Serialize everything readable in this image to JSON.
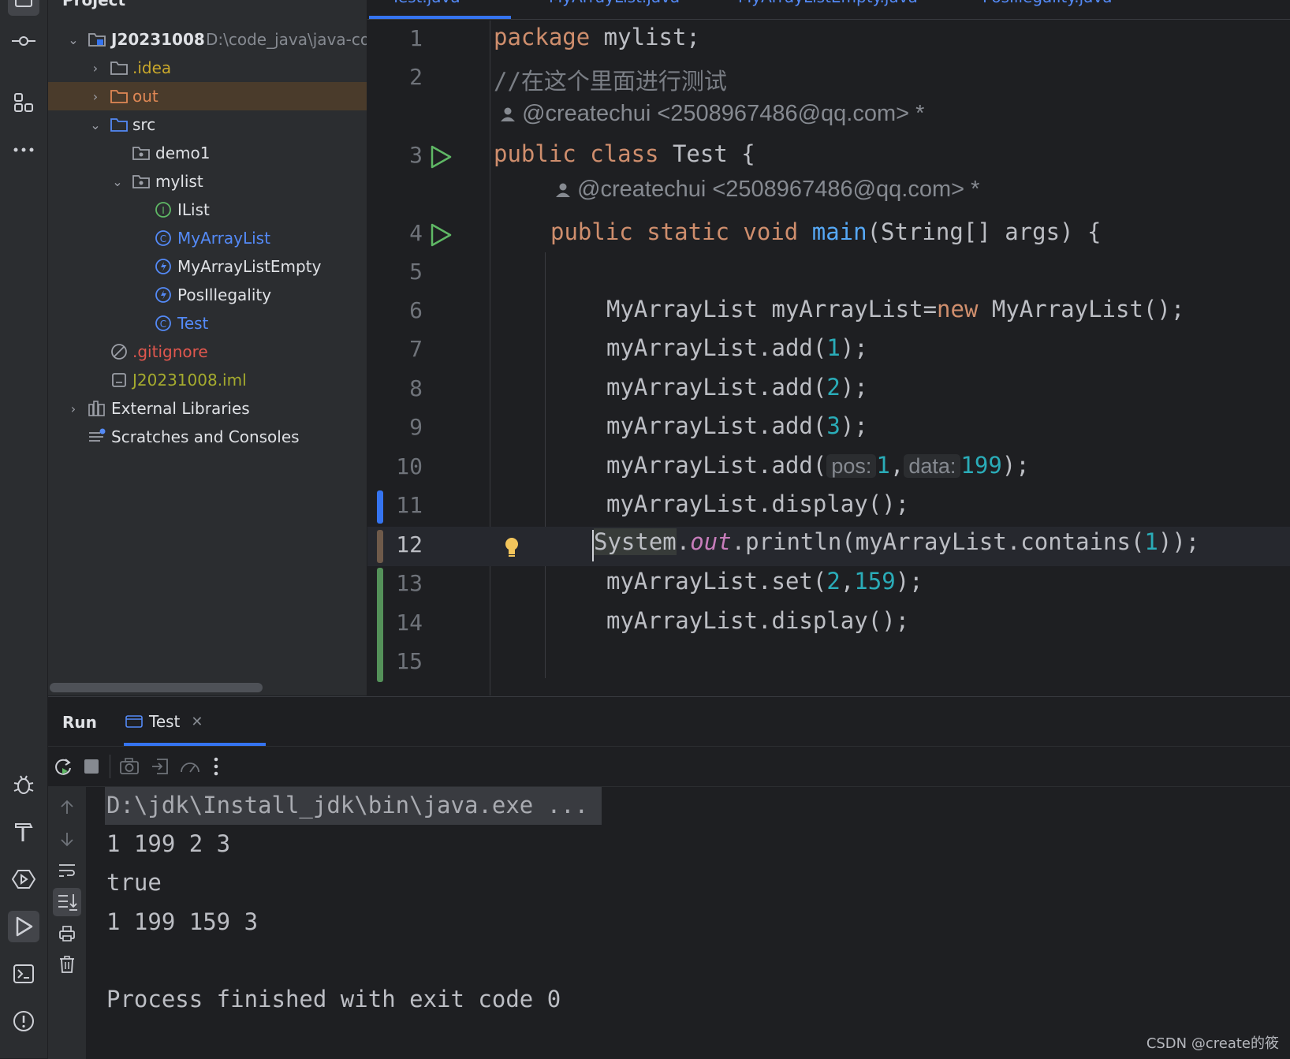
{
  "project": {
    "header": "Project",
    "root_name": "J20231008",
    "root_path": "D:\\code_java\\java-coc",
    "items": [
      {
        "label": ".idea"
      },
      {
        "label": "out"
      },
      {
        "label": "src"
      },
      {
        "label": "demo1"
      },
      {
        "label": "mylist"
      },
      {
        "label": "IList"
      },
      {
        "label": "MyArrayList"
      },
      {
        "label": "MyArrayListEmpty"
      },
      {
        "label": "PosIllegality"
      },
      {
        "label": "Test"
      },
      {
        "label": ".gitignore"
      },
      {
        "label": "J20231008.iml"
      },
      {
        "label": "External Libraries"
      },
      {
        "label": "Scratches and Consoles"
      }
    ]
  },
  "editor": {
    "tabs": [
      "Test.java",
      "MyArrayList.java",
      "MyArrayListEmpty.java",
      "PosIllegality.java"
    ],
    "line_numbers": [
      "1",
      "2",
      "3",
      "4",
      "5",
      "6",
      "7",
      "8",
      "9",
      "10",
      "11",
      "12",
      "13",
      "14",
      "15"
    ],
    "author_hint": "@createchui <2508967486@qq.com> *",
    "code": {
      "l1_kw": "package",
      "l1_rest": " mylist;",
      "l2": "//在这个里面进行测试",
      "l3_kw": "public class",
      "l3_rest": " Test {",
      "l4_kw": "public static void",
      "l4_fn": "main",
      "l4_rest": "(String[] args) {",
      "l6_a": "MyArrayList myArrayList=",
      "l6_kw": "new",
      "l6_b": " MyArrayList();",
      "l7_a": "myArrayList.add(",
      "l7_n": "1",
      "l7_b": ");",
      "l8_a": "myArrayList.add(",
      "l8_n": "2",
      "l8_b": ");",
      "l9_a": "myArrayList.add(",
      "l9_n": "3",
      "l9_b": ");",
      "l10_a": "myArrayList.add(",
      "l10_h1": "pos:",
      "l10_n1": "1",
      "l10_c": ",",
      "l10_h2": "data:",
      "l10_n2": "199",
      "l10_b": ");",
      "l11": "myArrayList.display();",
      "l12_a": "System",
      "l12_dot": ".",
      "l12_out": "out",
      "l12_b": ".println(myArrayList.contains(",
      "l12_n": "1",
      "l12_c": "));",
      "l13_a": "myArrayList.set(",
      "l13_n1": "2",
      "l13_c": ",",
      "l13_n2": "159",
      "l13_b": ");",
      "l14": "myArrayList.display();"
    }
  },
  "run": {
    "title": "Run",
    "tab": "Test",
    "output": [
      "D:\\jdk\\Install_jdk\\bin\\java.exe ...",
      "1 199 2 3",
      "true",
      "1 199 159 3",
      "",
      "Process finished with exit code 0"
    ]
  },
  "watermark": "CSDN @create的筱",
  "colors": {
    "keyword": "#cf8e6d",
    "function": "#56a8f5",
    "number": "#2aacb8",
    "static_field": "#c77dbb",
    "accent": "#3574f0"
  }
}
